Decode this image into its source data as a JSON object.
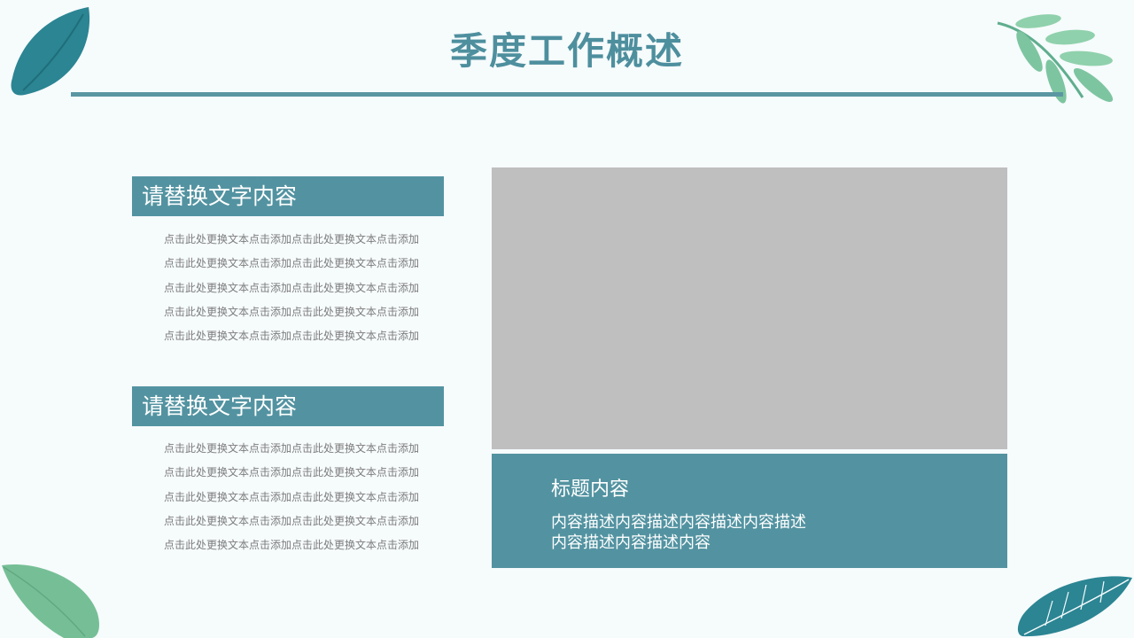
{
  "title": "季度工作概述",
  "sections": [
    {
      "heading": "请替换文字内容",
      "lines": [
        "点击此处更换文本点击添加点击此处更换文本点击添加",
        "点击此处更换文本点击添加点击此处更换文本点击添加",
        "点击此处更换文本点击添加点击此处更换文本点击添加",
        "点击此处更换文本点击添加点击此处更换文本点击添加",
        "点击此处更换文本点击添加点击此处更换文本点击添加"
      ]
    },
    {
      "heading": "请替换文字内容",
      "lines": [
        "点击此处更换文本点击添加点击此处更换文本点击添加",
        "点击此处更换文本点击添加点击此处更换文本点击添加",
        "点击此处更换文本点击添加点击此处更换文本点击添加",
        "点击此处更换文本点击添加点击此处更换文本点击添加",
        "点击此处更换文本点击添加点击此处更换文本点击添加"
      ]
    }
  ],
  "card": {
    "title": "标题内容",
    "desc_lines": [
      "内容描述内容描述内容描述内容描述",
      "内容描述内容描述内容"
    ]
  },
  "colors": {
    "accent": "#5393a1",
    "title": "#4e8f9e",
    "background": "#f6fbfc",
    "placeholder": "#bfbfbf",
    "leaf_dark": "#2b8593",
    "leaf_light": "#76bf96"
  },
  "decorations": [
    "leaf-top-left-icon",
    "branch-top-right-icon",
    "leaf-bottom-left-icon",
    "leaf-bottom-right-icon"
  ]
}
